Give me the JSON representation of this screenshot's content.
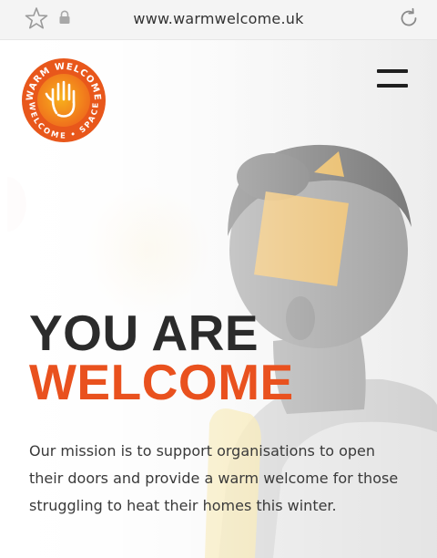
{
  "browser": {
    "url": "www.warmwelcome.uk",
    "icons": [
      "star-icon",
      "lock-icon",
      "reload-icon"
    ]
  },
  "header": {
    "logo_text_top": "WARM WELCOME",
    "logo_text_bottom": "WELCOME • SPACE",
    "menu_icon": "hamburger-menu-icon"
  },
  "hero": {
    "headline_line1": "YOU ARE",
    "headline_line2": "WELCOME",
    "mission_text": "Our mission is to support organisations to open their doors and provide a warm welcome for those struggling to heat their homes this winter."
  },
  "colors": {
    "accent": "#e9511e",
    "headline_dark": "#2b2b2b",
    "logo_orange": "#ef6a1c",
    "logo_yellow": "#f7b21c",
    "shape_yellow": "#f5b544"
  }
}
